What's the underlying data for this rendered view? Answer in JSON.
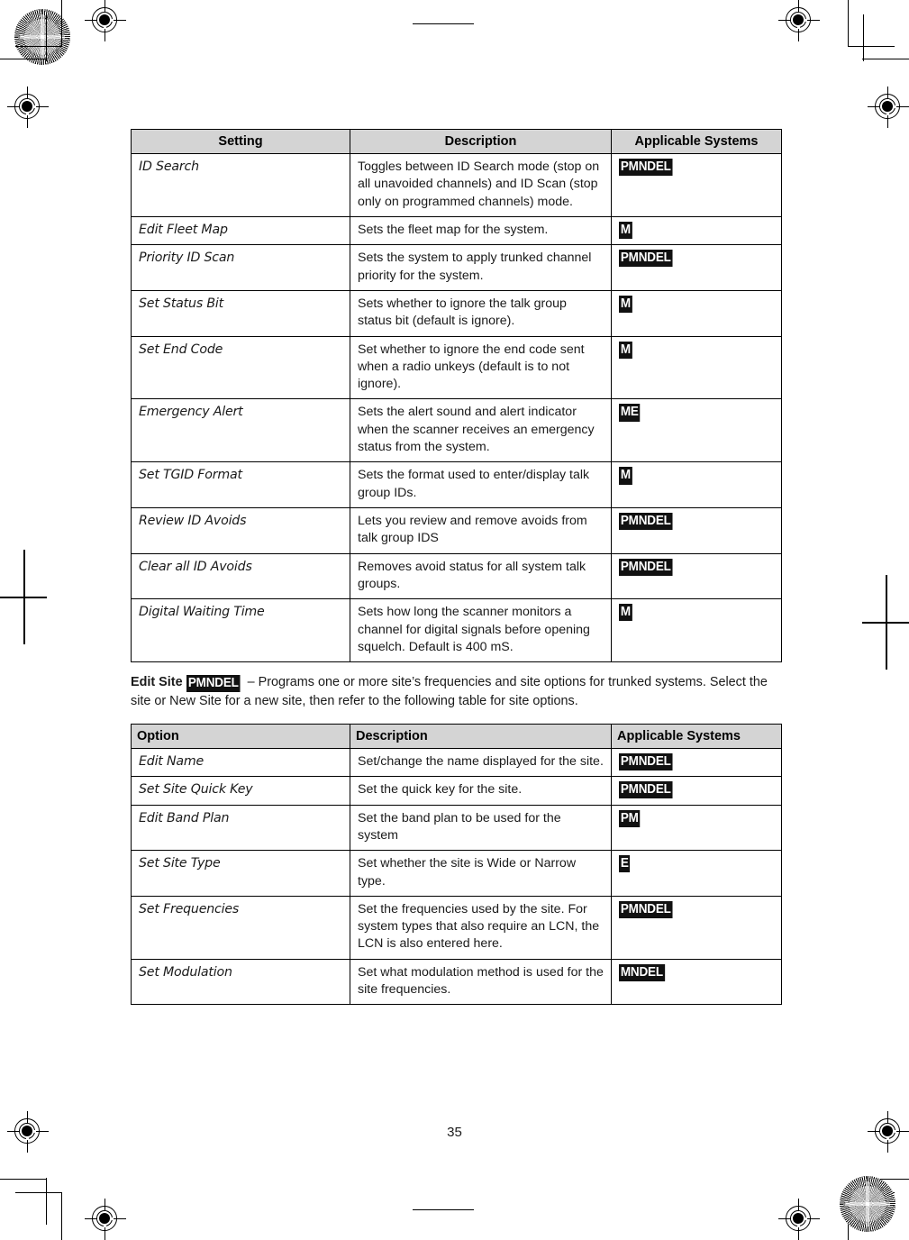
{
  "page": {
    "number": "35"
  },
  "table1": {
    "headers": {
      "col1": "Setting",
      "col2": "Description",
      "col3": "Applicable Systems"
    },
    "rows": [
      {
        "name": "ID Search",
        "description": "Toggles between ID Search mode (stop on all unavoided channels) and ID Scan (stop only on programmed channels) mode.",
        "systems": "PMNDEL"
      },
      {
        "name": "Edit Fleet Map",
        "description": "Sets the fleet map for the system.",
        "systems": "M"
      },
      {
        "name": "Priority ID Scan",
        "description": "Sets the system to apply trunked channel priority for the system.",
        "systems": "PMNDEL"
      },
      {
        "name": "Set Status Bit",
        "description": "Sets whether to ignore the talk group status bit (default is ignore).",
        "systems": "M"
      },
      {
        "name": "Set End Code",
        "description": "Set whether to ignore the end code sent when a radio unkeys (default is to not ignore).",
        "systems": "M"
      },
      {
        "name": "Emergency Alert",
        "description": "Sets the alert sound and alert indicator when the scanner receives an emergency status from the system.",
        "systems": "ME"
      },
      {
        "name": "Set TGID Format",
        "description": "Sets the format used to enter/display talk group IDs.",
        "systems": "M"
      },
      {
        "name": "Review ID Avoids",
        "description": "Lets you review and remove avoids from talk group IDS",
        "systems": "PMNDEL"
      },
      {
        "name": "Clear all ID Avoids",
        "description": "Removes avoid status for all system talk groups.",
        "systems": "PMNDEL"
      },
      {
        "name": "Digital Waiting Time",
        "description": "Sets how long the scanner monitors a channel for digital signals before opening squelch. Default is 400 mS.",
        "systems": "M"
      }
    ]
  },
  "paragraph": {
    "lead": "Edit Site",
    "badge": "PMNDEL",
    "text": " – Programs one or more site’s frequencies and site options for trunked systems. Select the site or New Site for a new site, then refer to the following table for site options."
  },
  "table2": {
    "headers": {
      "col1": "Option",
      "col2": "Description",
      "col3": "Applicable Systems"
    },
    "rows": [
      {
        "name": "Edit Name",
        "description": "Set/change the name displayed for the site.",
        "systems": "PMNDEL"
      },
      {
        "name": "Set Site Quick Key",
        "description": "Set the quick key for the site.",
        "systems": "PMNDEL"
      },
      {
        "name": "Edit Band Plan",
        "description": "Set the band plan to be used for the system",
        "systems": "PM"
      },
      {
        "name": "Set Site Type",
        "description": "Set whether the site is Wide or Narrow type.",
        "systems": "E"
      },
      {
        "name": "Set Frequencies",
        "description": "Set the frequencies used by the site. For system types that also require an LCN, the LCN is also entered here.",
        "systems": "PMNDEL"
      },
      {
        "name": "Set Modulation",
        "description": "Set what modulation method is used for the site frequencies.",
        "systems": "MNDEL"
      }
    ]
  },
  "print_marks": {
    "starburst_top_left": "starburst-registration-target",
    "starburst_bottom_right": "starburst-registration-target",
    "crosshairs": "crosshair-registration-target",
    "crop_marks": "crop-mark"
  },
  "colors": {
    "header_fill": "#d4d4d4",
    "badge_bg": "#111111",
    "badge_text": "#ffffff",
    "rule": "#000000"
  }
}
